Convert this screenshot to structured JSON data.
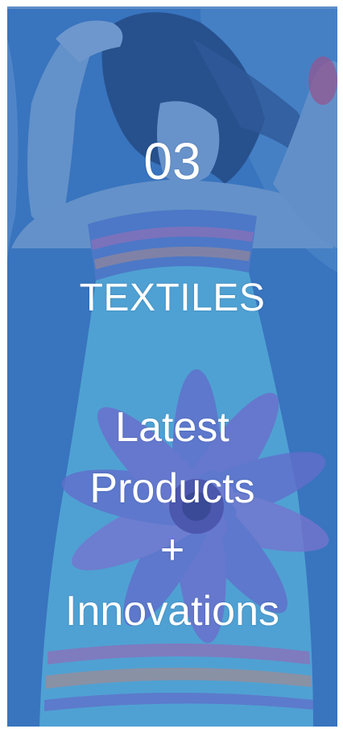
{
  "card": {
    "number": "03",
    "title": "TEXTILES",
    "tagline_lines": [
      "Latest",
      "Products",
      "+",
      "Innovations"
    ]
  },
  "colors": {
    "panel_blue": "#3a74c0",
    "overlay_blue": "#366eb9",
    "text": "#ffffff"
  }
}
